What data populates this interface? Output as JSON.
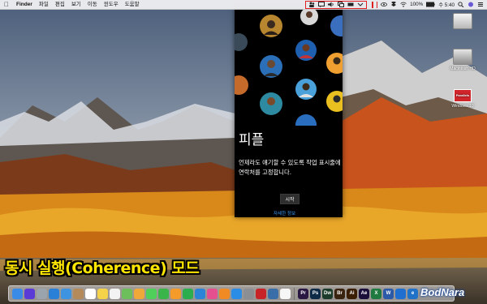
{
  "menubar": {
    "apple_icon": "apple-icon",
    "items": [
      "Finder",
      "파일",
      "편집",
      "보기",
      "이동",
      "윈도우",
      "도움말"
    ],
    "right": {
      "battery_text": "100%",
      "wifi_icon": "wifi-icon",
      "clock": "수 5:40"
    }
  },
  "desktop_icons": [
    {
      "label": ""
    },
    {
      "label": "Macintosh HD"
    },
    {
      "label": "Windows 10",
      "badge": "Parallels"
    }
  ],
  "people_panel": {
    "title": "피플",
    "description": "언제라도 얘기할 수 있도록 작업 표시줄에 연락처를 고정합니다.",
    "start_button": "시작",
    "more_link": "자세한 정보"
  },
  "caption": "동시 실행(Coherence) 모드",
  "watermark": "BodNara",
  "dock": {
    "apps": [
      {
        "name": "Finder",
        "color": "#3a8ae8",
        "glyph": ""
      },
      {
        "name": "Siri",
        "color": "#5b3bd6",
        "glyph": ""
      },
      {
        "name": "Launchpad",
        "color": "#9aa4ad",
        "glyph": ""
      },
      {
        "name": "Safari",
        "color": "#2a7fd6",
        "glyph": ""
      },
      {
        "name": "Mail",
        "color": "#3e94e0",
        "glyph": ""
      },
      {
        "name": "Contacts",
        "color": "#b58a5a",
        "glyph": ""
      },
      {
        "name": "Calendar",
        "color": "#ffffff",
        "glyph": ""
      },
      {
        "name": "Notes",
        "color": "#f4d34a",
        "glyph": ""
      },
      {
        "name": "Reminders",
        "color": "#f3f3f3",
        "glyph": ""
      },
      {
        "name": "Maps",
        "color": "#6cbf5a",
        "glyph": ""
      },
      {
        "name": "Photos",
        "color": "#f0a838",
        "glyph": ""
      },
      {
        "name": "Messages",
        "color": "#4fd05a",
        "glyph": ""
      },
      {
        "name": "FaceTime",
        "color": "#3ab54a",
        "glyph": ""
      },
      {
        "name": "Pages",
        "color": "#f49b2a",
        "glyph": ""
      },
      {
        "name": "Numbers",
        "color": "#2cae4f",
        "glyph": ""
      },
      {
        "name": "Keynote",
        "color": "#2b84d8",
        "glyph": ""
      },
      {
        "name": "iTunes",
        "color": "#e64f8f",
        "glyph": ""
      },
      {
        "name": "iBooks",
        "color": "#f28a24",
        "glyph": ""
      },
      {
        "name": "App Store",
        "color": "#2b8de6",
        "glyph": ""
      },
      {
        "name": "System Preferences",
        "color": "#8b8e93",
        "glyph": ""
      },
      {
        "name": "Parallels",
        "color": "#c7242a",
        "glyph": ""
      },
      {
        "name": "Time Machine",
        "color": "#3a6ea8",
        "glyph": ""
      },
      {
        "name": "Clock",
        "color": "#f6f6f6",
        "glyph": ""
      },
      {
        "name": "Pr",
        "color": "#2a1742",
        "glyph": "Pr"
      },
      {
        "name": "Ps",
        "color": "#0d2a47",
        "glyph": "Ps"
      },
      {
        "name": "Dw",
        "color": "#1b3c2a",
        "glyph": "Dw"
      },
      {
        "name": "Br",
        "color": "#3a2410",
        "glyph": "Br"
      },
      {
        "name": "Ai",
        "color": "#3a1f05",
        "glyph": "Ai"
      },
      {
        "name": "Ae",
        "color": "#1c0e3a",
        "glyph": "Ae"
      },
      {
        "name": "Excel",
        "color": "#1f7a3f",
        "glyph": "X"
      },
      {
        "name": "Word",
        "color": "#2a5aa8",
        "glyph": "W"
      },
      {
        "name": "Windows",
        "color": "#1e6fd0",
        "glyph": ""
      },
      {
        "name": "Edge",
        "color": "#1f72c8",
        "glyph": "e"
      }
    ]
  }
}
